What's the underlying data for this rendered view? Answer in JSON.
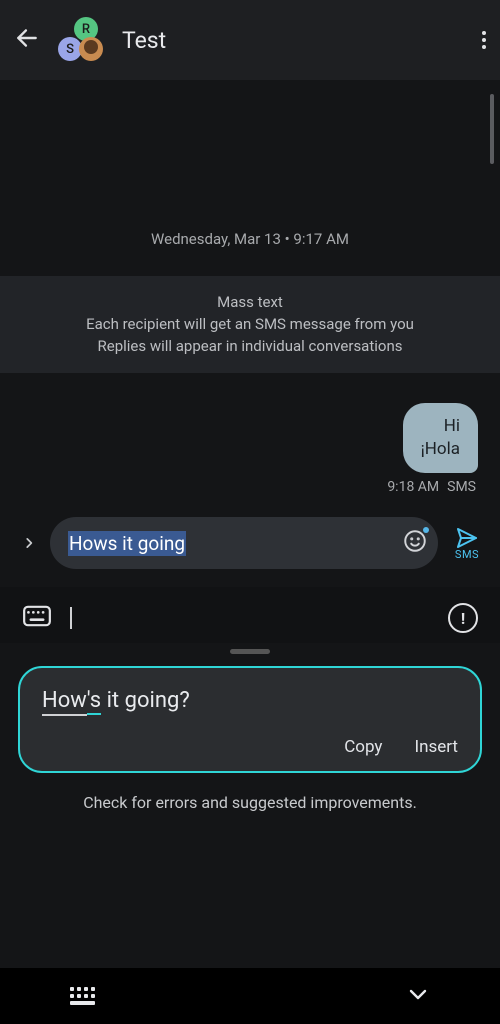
{
  "header": {
    "title": "Test",
    "avatars": {
      "r": "R",
      "s": "S"
    }
  },
  "conversation": {
    "timestamp": "Wednesday, Mar 13 • 9:17 AM",
    "info_banner": {
      "line1": "Mass text",
      "line2": "Each recipient will get an SMS message from you",
      "line3": "Replies will appear in individual conversations"
    },
    "message": {
      "text": "Hi\n¡Hola",
      "time": "9:18 AM",
      "via": "SMS"
    }
  },
  "compose": {
    "draft": "Hows it going",
    "send_label": "SMS"
  },
  "suggestion": {
    "prefix_underlined": "How",
    "corrected_segment": "'s",
    "rest": " it going?",
    "actions": {
      "copy": "Copy",
      "insert": "Insert"
    },
    "tip": "Check for errors and suggested improvements."
  }
}
